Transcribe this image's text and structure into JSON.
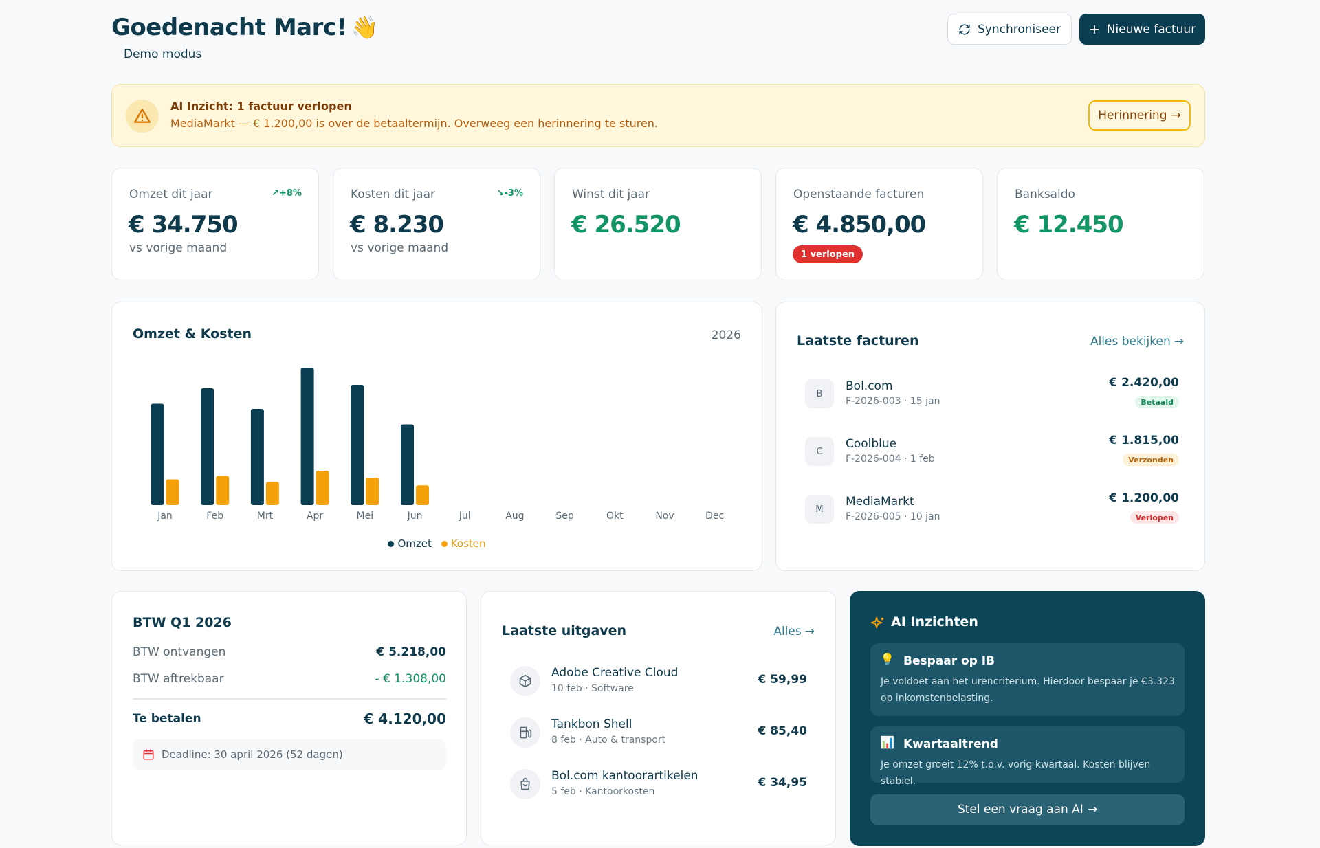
{
  "header": {
    "greeting": "Goedenacht Marc!",
    "wave": "👋",
    "mode": "Demo modus",
    "sync_label": "Synchroniseer",
    "new_invoice_label": "Nieuwe factuur"
  },
  "alert": {
    "title": "AI Inzicht: 1 factuur verlopen",
    "text": "MediaMarkt — € 1.200,00 is over de betaaltermijn. Overweeg een herinnering te sturen.",
    "button": "Herinnering"
  },
  "stats": [
    {
      "label": "Omzet dit jaar",
      "value": "€ 34.750",
      "trend": "+8%",
      "sub": "vs vorige maand"
    },
    {
      "label": "Kosten dit jaar",
      "value": "€ 8.230",
      "trend": "-3%",
      "sub": "vs vorige maand"
    },
    {
      "label": "Winst dit jaar",
      "value": "€ 26.520"
    },
    {
      "label": "Openstaande facturen",
      "value": "€ 4.850,00",
      "badge": "1 verlopen"
    },
    {
      "label": "Banksaldo",
      "value": "€ 12.450"
    }
  ],
  "chart": {
    "title": "Omzet & Kosten",
    "year": "2026"
  },
  "chart_data": {
    "type": "bar",
    "categories": [
      "Jan",
      "Feb",
      "Mrt",
      "Apr",
      "Mei",
      "Jun",
      "Jul",
      "Aug",
      "Sep",
      "Okt",
      "Nov",
      "Dec"
    ],
    "series": [
      {
        "name": "Omzet",
        "color": "#0b3e52",
        "values": [
          5900,
          6800,
          5600,
          8000,
          7000,
          4700,
          0,
          0,
          0,
          0,
          0,
          0
        ]
      },
      {
        "name": "Kosten",
        "color": "#f5a10a",
        "values": [
          1500,
          1700,
          1350,
          2000,
          1600,
          1150,
          0,
          0,
          0,
          0,
          0,
          0
        ]
      }
    ],
    "ylim": [
      0,
      8000
    ],
    "legend": "bottom-center",
    "grid": false
  },
  "invoices": {
    "title": "Laatste facturen",
    "link": "Alles bekijken",
    "items": [
      {
        "initial": "B",
        "name": "Bol.com",
        "meta": "F-2026-003 · 15 jan",
        "amount": "€ 2.420,00",
        "status": "Betaald"
      },
      {
        "initial": "C",
        "name": "Coolblue",
        "meta": "F-2026-004 · 1 feb",
        "amount": "€ 1.815,00",
        "status": "Verzonden"
      },
      {
        "initial": "M",
        "name": "MediaMarkt",
        "meta": "F-2026-005 · 10 jan",
        "amount": "€ 1.200,00",
        "status": "Verlopen"
      }
    ]
  },
  "btw": {
    "title": "BTW Q1 2026",
    "received_label": "BTW ontvangen",
    "received_value": "€ 5.218,00",
    "deductible_label": "BTW aftrekbaar",
    "deductible_value": "- € 1.308,00",
    "pay_label": "Te betalen",
    "pay_value": "€ 4.120,00",
    "deadline": "Deadline: 30 april 2026 (52 dagen)"
  },
  "expenses": {
    "title": "Laatste uitgaven",
    "link": "Alles",
    "items": [
      {
        "icon": "package-icon",
        "name": "Adobe Creative Cloud",
        "meta": "10 feb · Software",
        "amount": "€ 59,99"
      },
      {
        "icon": "fuel-icon",
        "name": "Tankbon Shell",
        "meta": "8 feb · Auto & transport",
        "amount": "€ 85,40"
      },
      {
        "icon": "shopping-bag-icon",
        "name": "Bol.com kantoorartikelen",
        "meta": "5 feb · Kantoorkosten",
        "amount": "€ 34,95"
      }
    ]
  },
  "ai": {
    "title": "AI Inzichten",
    "tips": [
      {
        "icon": "💡",
        "title": "Bespaar op IB",
        "text": "Je voldoet aan het urencriterium. Hierdoor bespaar je €3.323 op inkomstenbelasting."
      },
      {
        "icon": "📊",
        "title": "Kwartaaltrend",
        "text": "Je omzet groeit 12% t.o.v. vorig kwartaal. Kosten blijven stabiel."
      }
    ],
    "button": "Stel een vraag aan AI"
  },
  "colors": {
    "primary": "#0b3e52",
    "accent": "#f5a10a",
    "green": "#139464",
    "red": "#e03131"
  }
}
